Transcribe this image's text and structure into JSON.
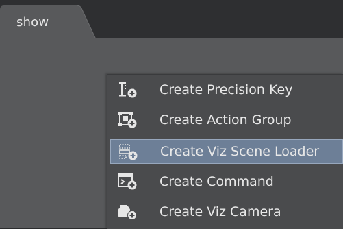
{
  "tab": {
    "label": "show"
  },
  "menu": {
    "items": [
      {
        "label": "Create Precision Key",
        "icon": "precision-key-icon"
      },
      {
        "label": "Create Action Group",
        "icon": "action-group-icon"
      },
      {
        "label": "Create Viz Scene Loader",
        "icon": "scene-loader-icon",
        "selected": true
      },
      {
        "label": "Create Command",
        "icon": "command-icon"
      },
      {
        "label": "Create Viz Camera",
        "icon": "camera-icon"
      }
    ]
  },
  "colors": {
    "background": "#2b2c2e",
    "panel": "#58595b",
    "menu": "#4a4b4d",
    "selection": "#6d7f97",
    "text": "#e8e8e8"
  }
}
